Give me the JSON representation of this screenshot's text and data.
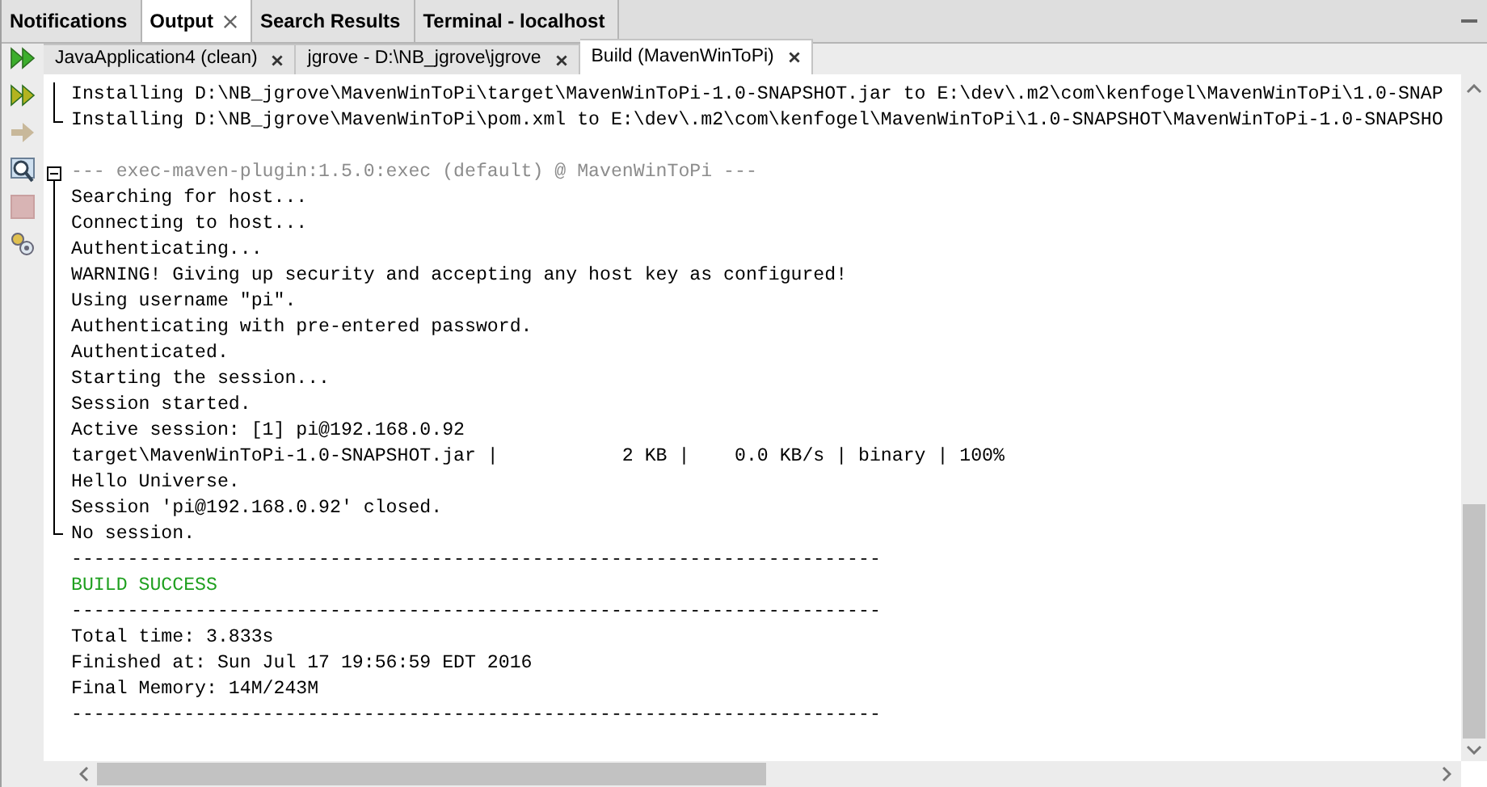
{
  "panel_tabs": [
    {
      "label": "Notifications",
      "selected": false,
      "closable": false
    },
    {
      "label": "Output",
      "selected": true,
      "closable": true
    },
    {
      "label": "Search Results",
      "selected": false,
      "closable": false
    },
    {
      "label": "Terminal - localhost",
      "selected": false,
      "closable": false
    }
  ],
  "toolbar": [
    {
      "kind": "rerun",
      "disabled": false
    },
    {
      "kind": "rerun-goals",
      "disabled": false
    },
    {
      "kind": "forward",
      "disabled": true
    },
    {
      "kind": "inspect",
      "disabled": false
    },
    {
      "kind": "stop",
      "disabled": true
    },
    {
      "kind": "settings",
      "disabled": false
    }
  ],
  "output_tabs": [
    {
      "label": "JavaApplication4 (clean)",
      "selected": false
    },
    {
      "label": "jgrove - D:\\NB_jgrove\\jgrove",
      "selected": false
    },
    {
      "label": "Build (MavenWinToPi)",
      "selected": true
    }
  ],
  "lines": [
    {
      "kind": "group-tail",
      "children": [
        {
          "text": "Installing D:\\NB_jgrove\\MavenWinToPi\\target\\MavenWinToPi-1.0-SNAPSHOT.jar to E:\\dev\\.m2\\com\\kenfogel\\MavenWinToPi\\1.0-SNAP",
          "kind": "normal"
        },
        {
          "text": "Installing D:\\NB_jgrove\\MavenWinToPi\\pom.xml to E:\\dev\\.m2\\com\\kenfogel\\MavenWinToPi\\1.0-SNAPSHOT\\MavenWinToPi-1.0-SNAPSHO",
          "kind": "normal"
        }
      ]
    },
    {
      "kind": "blank"
    },
    {
      "kind": "group",
      "expanded": true,
      "children": [
        {
          "text": "--- exec-maven-plugin:1.5.0:exec (default) @ MavenWinToPi ---",
          "kind": "muted"
        },
        {
          "text": "Searching for host...",
          "kind": "normal"
        },
        {
          "text": "Connecting to host...",
          "kind": "normal"
        },
        {
          "text": "Authenticating...",
          "kind": "normal"
        },
        {
          "text": "WARNING! Giving up security and accepting any host key as configured!",
          "kind": "normal"
        },
        {
          "text": "Using username \"pi\".",
          "kind": "normal"
        },
        {
          "text": "Authenticating with pre-entered password.",
          "kind": "normal"
        },
        {
          "text": "Authenticated.",
          "kind": "normal"
        },
        {
          "text": "Starting the session...",
          "kind": "normal"
        },
        {
          "text": "Session started.",
          "kind": "normal"
        },
        {
          "text": "Active session: [1] pi@192.168.0.92",
          "kind": "normal"
        },
        {
          "text": "target\\MavenWinToPi-1.0-SNAPSHOT.jar |           2 KB |    0.0 KB/s | binary | 100%",
          "kind": "normal"
        },
        {
          "text": "Hello Universe.",
          "kind": "normal"
        },
        {
          "text": "Session 'pi@192.168.0.92' closed.",
          "kind": "normal"
        },
        {
          "text": "No session.",
          "kind": "normal"
        }
      ]
    },
    {
      "text": "------------------------------------------------------------------------",
      "kind": "normal"
    },
    {
      "text": "BUILD SUCCESS",
      "kind": "success"
    },
    {
      "text": "------------------------------------------------------------------------",
      "kind": "normal"
    },
    {
      "text": "Total time: 3.833s",
      "kind": "normal"
    },
    {
      "text": "Finished at: Sun Jul 17 19:56:59 EDT 2016",
      "kind": "normal"
    },
    {
      "text": "Final Memory: 14M/243M",
      "kind": "normal"
    },
    {
      "text": "------------------------------------------------------------------------",
      "kind": "normal"
    }
  ]
}
